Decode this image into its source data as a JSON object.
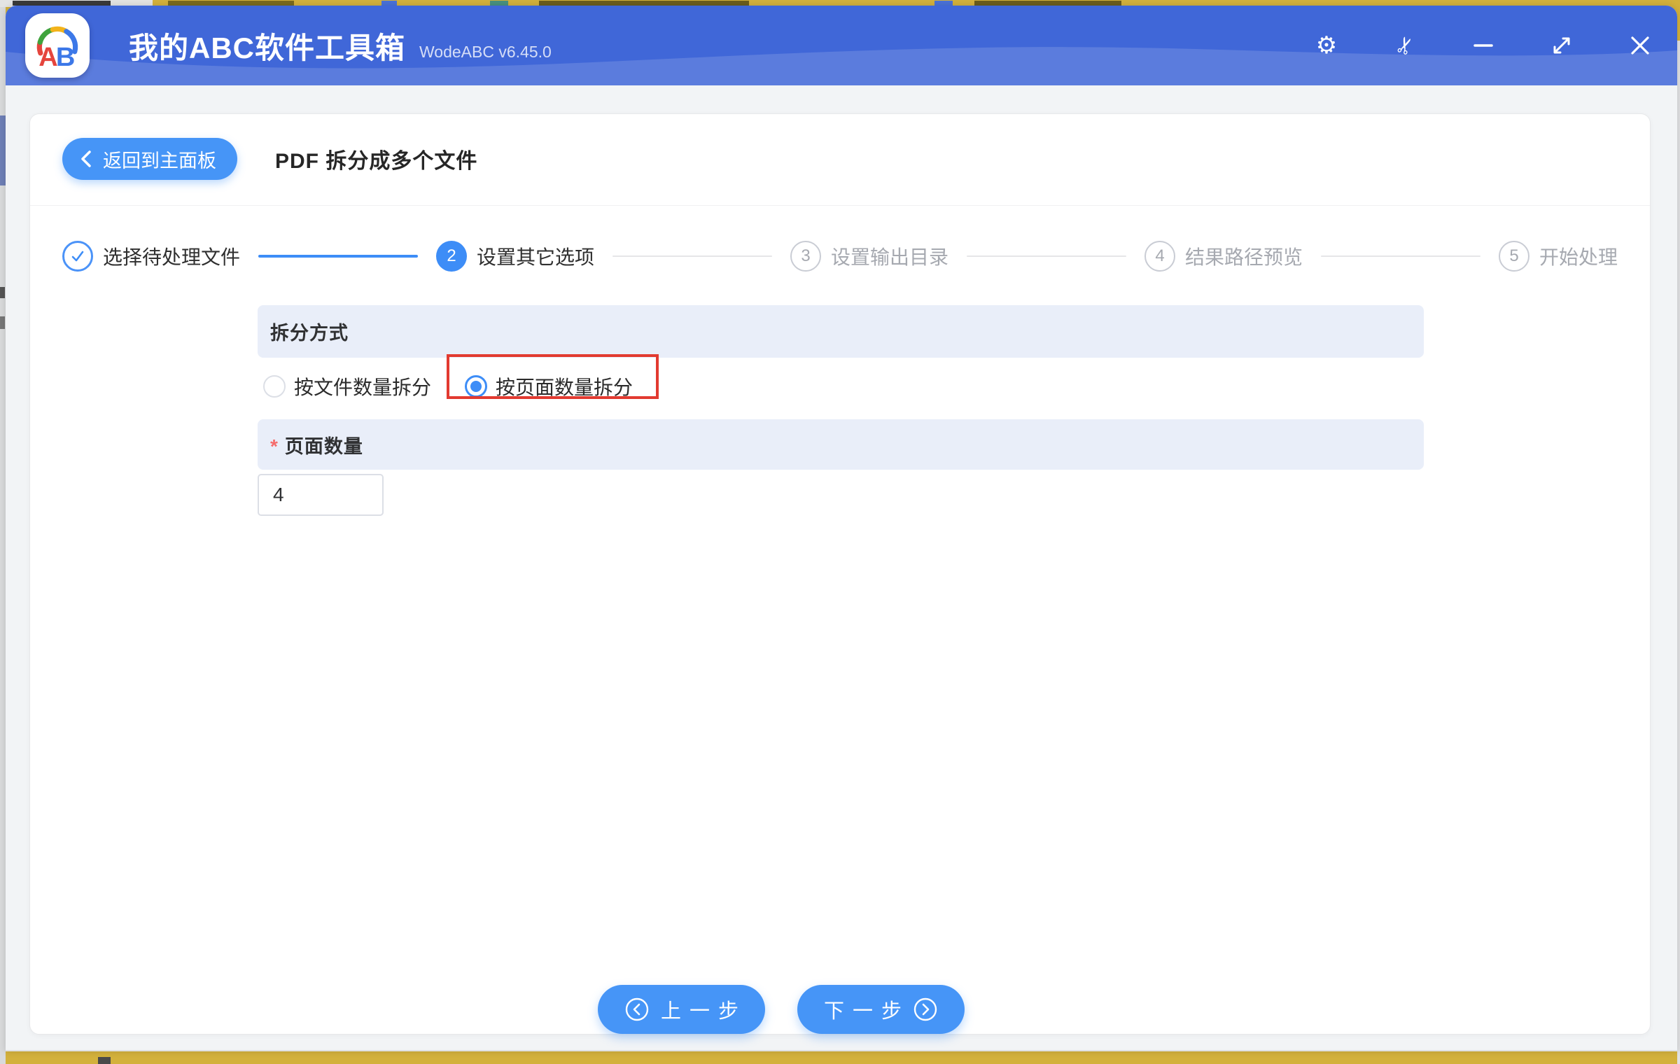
{
  "titlebar": {
    "logo_text": "AB",
    "title": "我的ABC软件工具箱",
    "version": "WodeABC v6.45.0",
    "control_icons": [
      "settings-icon",
      "scissors-icon",
      "minimize-icon",
      "resize-icon",
      "close-icon"
    ]
  },
  "header": {
    "back_button": "返回到主面板",
    "page_title": "PDF 拆分成多个文件"
  },
  "steps": {
    "items": [
      {
        "number": "1",
        "label": "选择待处理文件",
        "state": "done"
      },
      {
        "number": "2",
        "label": "设置其它选项",
        "state": "active"
      },
      {
        "number": "3",
        "label": "设置输出目录",
        "state": "pending"
      },
      {
        "number": "4",
        "label": "结果路径预览",
        "state": "pending"
      },
      {
        "number": "5",
        "label": "开始处理",
        "state": "pending"
      }
    ]
  },
  "form": {
    "split_method": {
      "label": "拆分方式",
      "options": [
        {
          "label": "按文件数量拆分",
          "selected": false,
          "highlighted": false
        },
        {
          "label": "按页面数量拆分",
          "selected": true,
          "highlighted": true
        }
      ]
    },
    "page_count": {
      "label": "页面数量",
      "required_mark": "*",
      "value": "4"
    }
  },
  "footer": {
    "prev_button": "上一步",
    "next_button": "下一步"
  },
  "colors": {
    "titlebar_blue": "#4067d8",
    "titlebar_wave": "#5b7ee1",
    "accent_blue": "#3d8df7",
    "button_blue": "#4695f7",
    "section_bg": "#e9eef9",
    "highlight_red": "#e23a30",
    "required_red": "#f56c6c",
    "pending_gray": "#a6a9b0",
    "background_yellow_sliver": "#d3b13c"
  }
}
